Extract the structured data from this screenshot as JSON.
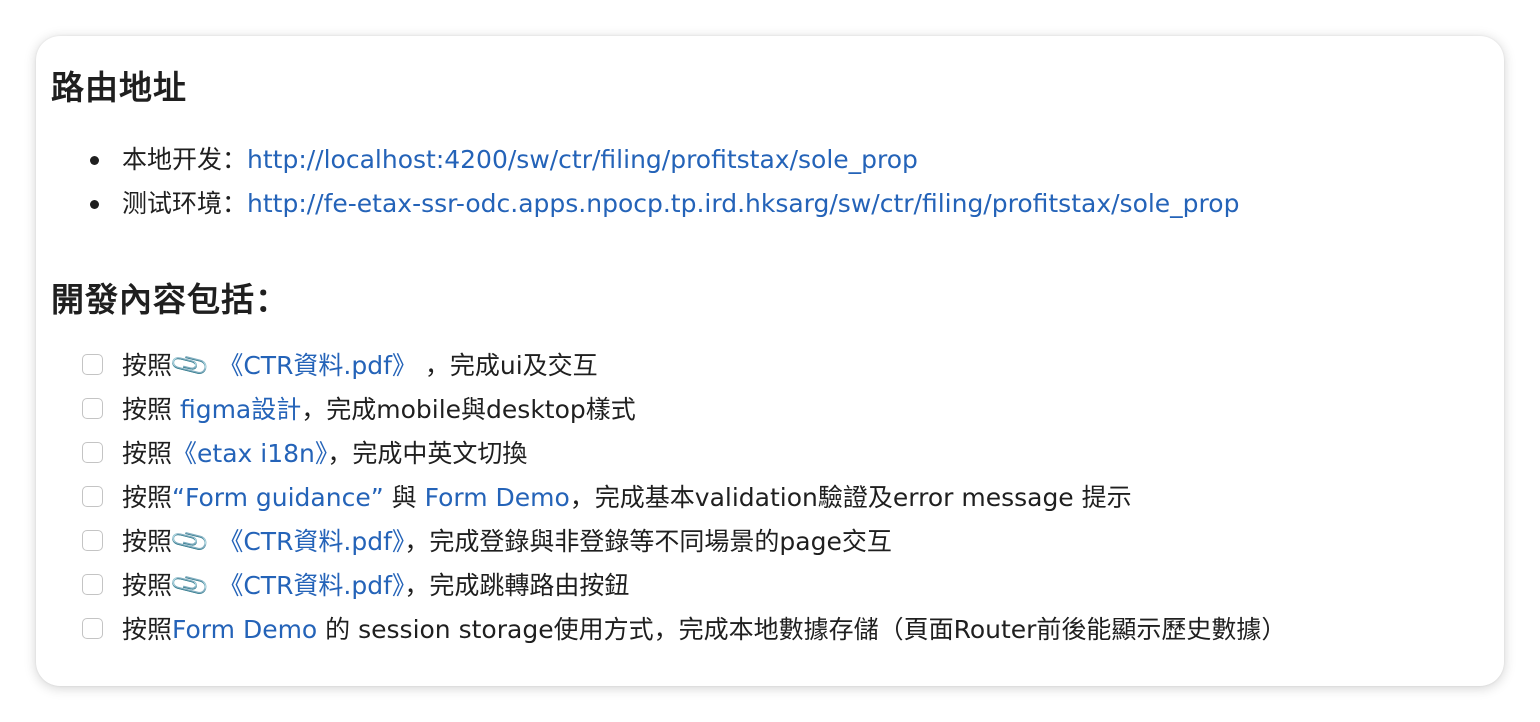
{
  "route_section": {
    "heading": "路由地址",
    "items": [
      {
        "label": "本地开发：",
        "url": "http://localhost:4200/sw/ctr/filing/profitstax/sole_prop"
      },
      {
        "label": "测试环境：",
        "url": "http://fe-etax-ssr-odc.apps.npocp.tp.ird.hksarg/sw/ctr/filing/profitstax/sole_prop"
      }
    ]
  },
  "dev_section": {
    "heading": "開發內容包括：",
    "tasks": [
      {
        "prefix": "按照",
        "clip": "📎",
        "link": " 《CTR資料.pdf》 ",
        "suffix": "，完成ui及交互"
      },
      {
        "prefix": "按照 ",
        "link": "figma設計",
        "suffix": "，完成mobile與desktop樣式"
      },
      {
        "prefix": "按照",
        "link": "《etax i18n》",
        "suffix": "，完成中英文切換"
      },
      {
        "prefix": "按照",
        "link": "“Form guidance”",
        "middle": " 與 ",
        "link2": "Form Demo",
        "suffix": "，完成基本validation驗證及error message 提示"
      },
      {
        "prefix": "按照",
        "clip": "📎",
        "link": " 《CTR資料.pdf》",
        "suffix": "，完成登錄與非登錄等不同場景的page交互"
      },
      {
        "prefix": "按照",
        "clip": "📎",
        "link": " 《CTR資料.pdf》",
        "suffix": "，完成跳轉路由按鈕"
      },
      {
        "prefix": "按照",
        "link": "Form Demo",
        "suffix": " 的 session storage使用方式，完成本地數據存儲（頁面Router前後能顯示歷史數據）"
      }
    ]
  },
  "icons": {
    "attachment": "paperclip-icon",
    "checkbox": "checkbox-unchecked"
  }
}
